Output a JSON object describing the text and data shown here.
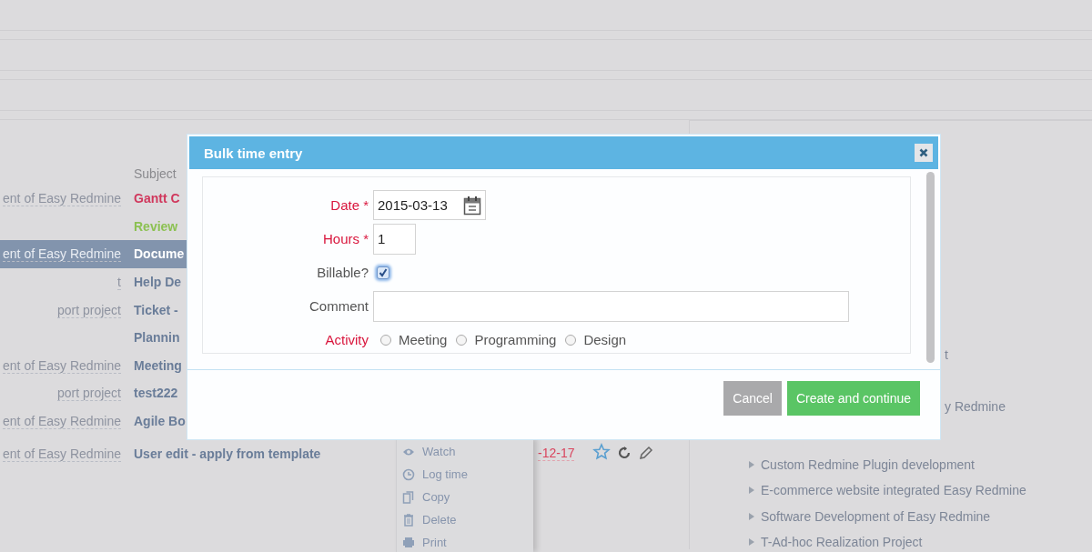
{
  "table": {
    "header_subject": "Subject",
    "rows": [
      {
        "project": "ent of Easy Redmine",
        "subject": "Gantt C",
        "color": "#d0375c",
        "selected": false
      },
      {
        "subject": "Review",
        "color": "#8cc152",
        "selected": false
      },
      {
        "project": "ent of Easy Redmine",
        "subject": "Docume",
        "color": "#ffffff",
        "selected": true
      },
      {
        "project": "t",
        "subject": "Help De",
        "color": "#6a7d99",
        "selected": false
      },
      {
        "project": "port project",
        "subject": "Ticket -",
        "color": "#6a7d99",
        "selected": false
      },
      {
        "subject": "Plannin",
        "color": "#6a7d99",
        "selected": false
      },
      {
        "project": "ent of Easy Redmine",
        "subject": "Meeting",
        "color": "#6a7d99",
        "selected": false
      },
      {
        "project": "port project",
        "subject": "test222",
        "color": "#6a7d99",
        "selected": false
      },
      {
        "project": "ent of Easy Redmine",
        "subject": "Agile Bo",
        "color": "#6a7d99",
        "selected": false
      },
      {
        "project": "ent of Easy Redmine",
        "subject": "User edit - apply from template",
        "color": "#6a7d99",
        "selected": false,
        "date": "-12-17"
      }
    ]
  },
  "context_menu": [
    {
      "label": "Watch",
      "kind": "watch"
    },
    {
      "label": "Log time",
      "kind": "log"
    },
    {
      "label": "Copy",
      "kind": "copy"
    },
    {
      "label": "Delete",
      "kind": "delete"
    },
    {
      "label": "Print",
      "kind": "print"
    }
  ],
  "projects": [
    {
      "label": "t",
      "kind": "fragment"
    },
    {
      "label": "y Redmine",
      "kind": "fragment"
    },
    {
      "label": "Custom Redmine Plugin development",
      "kind": "project"
    },
    {
      "label": "E-commerce website integrated Easy Redmine",
      "kind": "project"
    },
    {
      "label": "Software Development of Easy Redmine",
      "kind": "project"
    },
    {
      "label": "T-Ad-hoc Realization Project",
      "kind": "project"
    }
  ],
  "dialog": {
    "title": "Bulk time entry",
    "fields": [
      {
        "kind": "date",
        "label": "Date *",
        "required": true,
        "value": "2015-03-13"
      },
      {
        "kind": "number",
        "label": "Hours *",
        "required": true,
        "value": "1"
      },
      {
        "kind": "checkbox",
        "label": "Billable?",
        "required": false,
        "checked": true
      },
      {
        "kind": "text",
        "label": "Comment",
        "required": false
      },
      {
        "kind": "radio",
        "label": "Activity",
        "required": true,
        "options": [
          {
            "label": "Meeting",
            "selected": false
          },
          {
            "label": "Programming",
            "selected": false
          },
          {
            "label": "Design",
            "selected": false
          }
        ]
      }
    ],
    "buttons": [
      {
        "label": "Cancel",
        "kind": "secondary"
      },
      {
        "label": "Create and continue",
        "kind": "primary"
      }
    ]
  }
}
